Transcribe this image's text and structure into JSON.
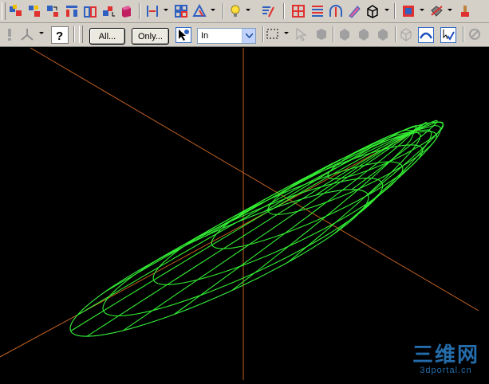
{
  "toolbar_top": {
    "icons": [
      "bring-to-front-icon",
      "send-to-back-icon",
      "group-icon",
      "align-icon",
      "array-icon",
      "union-icon",
      "cube-icon",
      "dimension-icon",
      "grid-icon",
      "delta-icon",
      "lightbulb-icon",
      "text-edit-icon",
      "table-grid-icon",
      "list-icon",
      "arc-icon",
      "pencil-icon",
      "box-icon",
      "select-layer-icon",
      "display-mode-icon",
      "paint-icon"
    ]
  },
  "toolbar_bottom": {
    "all_button": "All...",
    "only_button": "Only...",
    "units_select": {
      "value": "In",
      "options": [
        "In"
      ]
    }
  },
  "watermark": {
    "cn": "三维网",
    "url": "3dportal.cn"
  },
  "colors": {
    "toolbar": "#d4d0c8",
    "viewport": "#000000",
    "wire": "#33ee33",
    "axis": "#c06020",
    "silhouette": "#4060ff",
    "watermark": "#2b7fc8"
  }
}
